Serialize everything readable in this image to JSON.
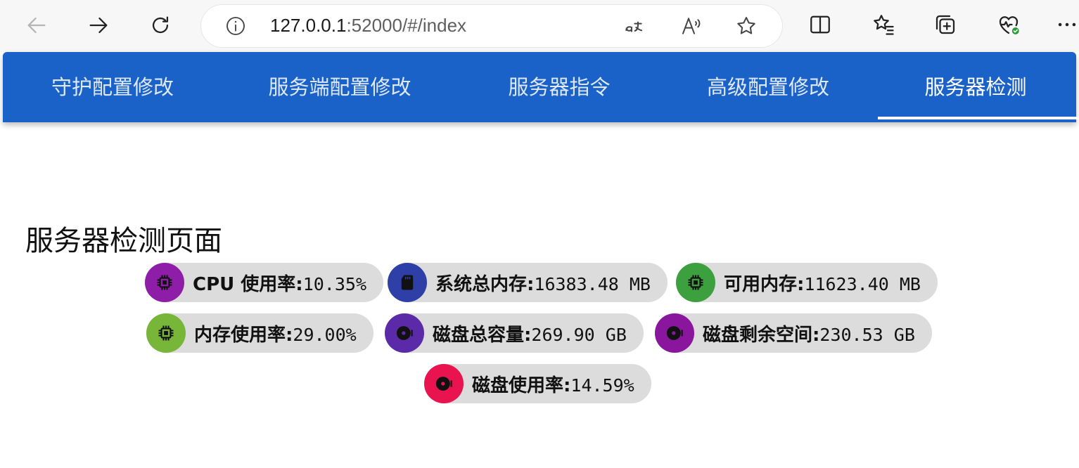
{
  "browser": {
    "url_host": "127.0.0.1",
    "url_rest": ":52000/#/index",
    "read_aloud_glyph": "A⁾"
  },
  "nav": {
    "tabs": [
      {
        "label": "守护配置修改"
      },
      {
        "label": "服务端配置修改"
      },
      {
        "label": "服务器指令"
      },
      {
        "label": "高级配置修改"
      },
      {
        "label": "服务器检测"
      }
    ],
    "active_index": 4,
    "background_color": "#1a62c8"
  },
  "page": {
    "title": "服务器检测页面"
  },
  "stats": [
    {
      "label": "CPU 使用率:",
      "value": "10.35%",
      "icon": "cpu-icon",
      "color": "#8e1ea8"
    },
    {
      "label": "系统总内存:",
      "value": "16383.48 MB",
      "icon": "memory-card-icon",
      "color": "#2e3fa8"
    },
    {
      "label": "可用内存:",
      "value": "11623.40 MB",
      "icon": "cpu-icon",
      "color": "#3da03f"
    },
    {
      "label": "内存使用率:",
      "value": "29.00%",
      "icon": "cpu-icon",
      "color": "#78b63a"
    },
    {
      "label": "磁盘总容量:",
      "value": "269.90 GB",
      "icon": "disk-icon",
      "color": "#5a2aa8"
    },
    {
      "label": "磁盘剩余空间:",
      "value": "230.53 GB",
      "icon": "disk-icon",
      "color": "#8a169e"
    },
    {
      "label": "磁盘使用率:",
      "value": "14.59%",
      "icon": "disk-icon",
      "color": "#e8134f"
    }
  ]
}
